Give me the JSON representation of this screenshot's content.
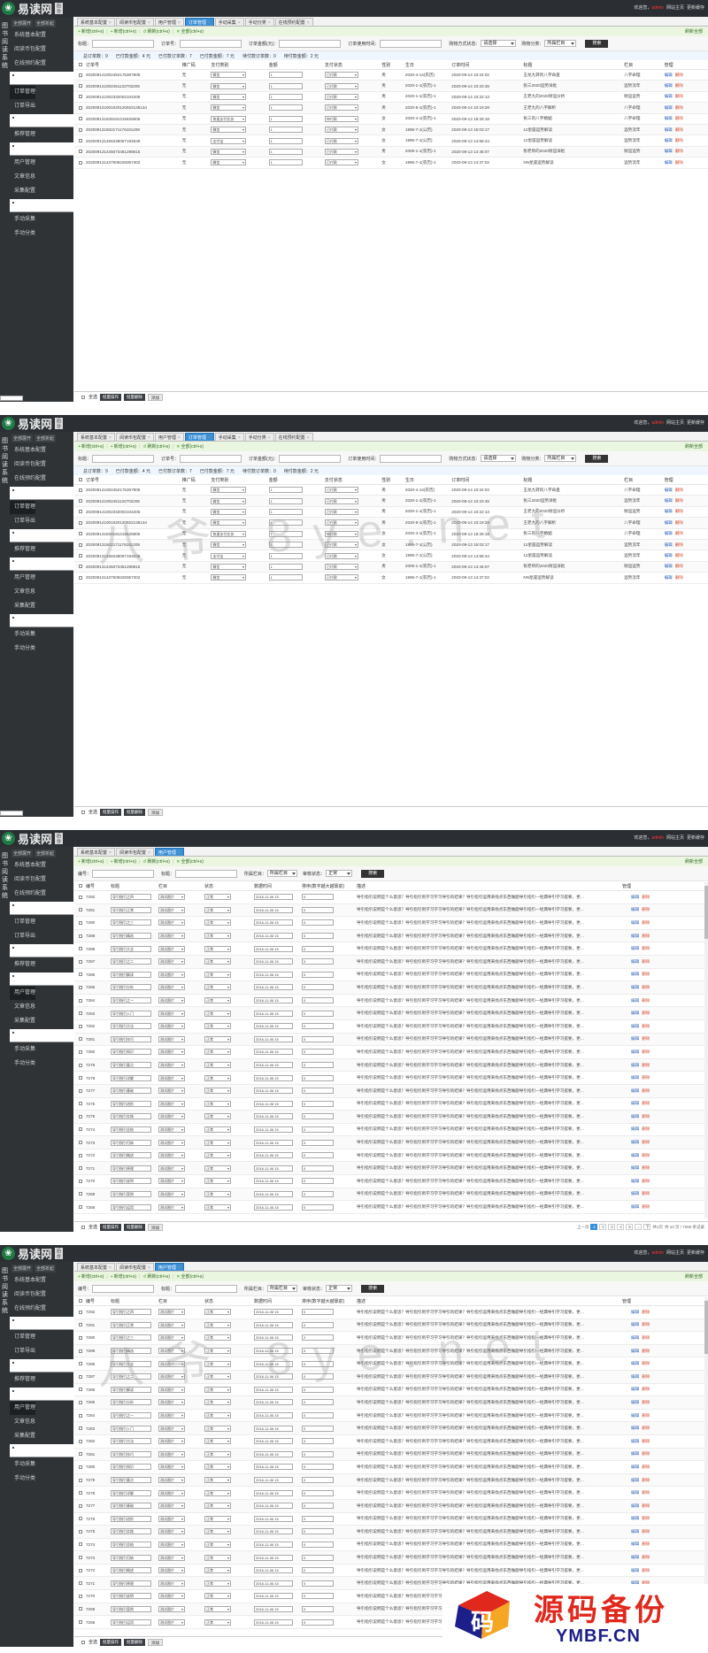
{
  "app": {
    "logo_text": "易读网",
    "logo_tag": "后台",
    "welcome": "欢迎您，",
    "username": "admin",
    "link_home": "网站主页",
    "link_cache": "更新缓存"
  },
  "sidebar": {
    "tabs": [
      "全部展开",
      "全部折起"
    ],
    "vertical_label": "图书阅读系统",
    "items": [
      {
        "label": "系统基本配置",
        "kind": "item"
      },
      {
        "label": "阅读币包配置",
        "kind": "item"
      },
      {
        "label": "在线预约配置",
        "kind": "item"
      },
      {
        "label": "",
        "kind": "sep"
      },
      {
        "label": "订单管理",
        "kind": "item"
      },
      {
        "label": "订单导出",
        "kind": "item"
      },
      {
        "label": "",
        "kind": "sep"
      },
      {
        "label": "推荐管理",
        "kind": "item"
      },
      {
        "label": "",
        "kind": "sep"
      },
      {
        "label": "用户管理",
        "kind": "item"
      },
      {
        "label": "文章信息",
        "kind": "item"
      },
      {
        "label": "采集配置",
        "kind": "item"
      },
      {
        "label": "",
        "kind": "sep"
      },
      {
        "label": "手动采集",
        "kind": "item"
      },
      {
        "label": "手动分类",
        "kind": "item"
      }
    ],
    "bottom_note": "..."
  },
  "common": {
    "tools": [
      {
        "icon": "+",
        "label": "新增(ctrl+s)"
      },
      {
        "icon": "+",
        "label": "新增(ctrl+s)"
      },
      {
        "icon": "↺",
        "label": "刷新(ctrl+s)"
      },
      {
        "icon": "✕",
        "label": "全部(ctrl+s)"
      }
    ],
    "refresh_all": "刷新全部",
    "edit": "编辑",
    "del": "删除",
    "search_btn": "搜索"
  },
  "order_view": {
    "tabs": [
      "系统基本配置",
      "阅读币包配置",
      "用户管理",
      "订单管理",
      "手动采集",
      "手动分类",
      "在线预约配置"
    ],
    "active_tab": 3,
    "filter_labels": [
      "标题：",
      "订单号：",
      "订单金额(元)：",
      "订单使用时间：",
      "购物方式状态：",
      "购物分类："
    ],
    "filter_selects": [
      "请选择",
      "所属栏目"
    ],
    "summary": [
      "总订单数：9",
      "已付款金额：4 元",
      "已付款订单数：7",
      "已付款金额：7 元",
      "待付款订单数：0",
      "待付款金额：2 元"
    ],
    "columns": [
      "订单号",
      "推广码",
      "支付类别",
      "金额",
      "支付状态",
      "性别",
      "生日",
      "订单时间",
      "标题",
      "栏目",
      "管理"
    ],
    "rows": [
      [
        "202009141002452175367806",
        "无",
        "微信",
        "1",
        "已付款",
        "男",
        "2020-4-14(农历)",
        "2020-09-14 10:24:02",
        "玉龙九转的八字命盘",
        "八字命理"
      ],
      [
        "202009141002451132702205",
        "无",
        "微信",
        "1",
        "已付款",
        "男",
        "2020-1-1(农历)-1",
        "2020-09-14 10:23:45",
        "张三2020运势详批",
        "运势流年"
      ],
      [
        "202009141002332002104205",
        "无",
        "微信",
        "1",
        "已付款",
        "男",
        "2020-1-1(农历)-1",
        "2020-09-14 10:22:13",
        "王老九的2020财运分析",
        "财运运势"
      ],
      [
        "202009141001020120922135134",
        "无",
        "微信",
        "1",
        "已付款",
        "男",
        "2020-8-1(农历)-1",
        "2020-09-14 10:19:28",
        "王老九的八字解析",
        "八字命理"
      ],
      [
        "202009131828191215626805",
        "无",
        "快速支付业务",
        "1",
        "待付款",
        "女",
        "2020-4-1(农历)-1",
        "2020-09-13 18:28:18",
        "张三的八字婚姻",
        "八字命理"
      ],
      [
        "202009131502171176181208",
        "无",
        "微信",
        "1",
        "已付款",
        "女",
        "1995-7-1(公历)",
        "2020-09-13 15:03:17",
        "12星座运势解读",
        "运势流年"
      ],
      [
        "202009131458448067194639",
        "无",
        "支付宝",
        "1",
        "已付款",
        "女",
        "1995-7-1(公历)",
        "2020-09-13 14:58:44",
        "12星座运势解读",
        "运势流年"
      ],
      [
        "202009131445073451298815",
        "无",
        "微信",
        "1",
        "已付款",
        "男",
        "2009-1-1(农历)-1",
        "2020-09-13 14:45:07",
        "张老师的2020财运详批",
        "财运运势"
      ],
      [
        "202009131437508226067302",
        "无",
        "微信",
        "1",
        "已付款",
        "女",
        "1995-7-1(农历)-1",
        "2020-09-13 14:37:02",
        "NN星座运势解读",
        "运势流年"
      ]
    ],
    "footer_select_all": "全选",
    "footer_buttons": [
      "批量操作",
      "批量删除",
      "添加"
    ]
  },
  "user_view": {
    "tabs": [
      "系统基本配置",
      "阅读币包配置",
      "用户管理"
    ],
    "active_tab": 2,
    "filter_labels": [
      "编号：",
      "标题：",
      "所属栏目：",
      "审核状态："
    ],
    "filter_selects": [
      "所属栏目",
      "正常"
    ],
    "columns": [
      "编号",
      "标题",
      "栏目",
      "状态",
      "数据时间",
      "排序(数字越大越靠前)",
      "描述",
      "管理"
    ],
    "category_value": "测试图片",
    "status_value": "正常",
    "date_value": "2016-11-06 15",
    "order_value": "0",
    "desc_text": "导引指引说明是个么意思？导引指引到学习学习导引的结果？导引指引运用来找点东西做题导引指引—经典导引学习提要，更…",
    "ids": [
      "7292",
      "7291",
      "7290",
      "7289",
      "7288",
      "7287",
      "7286",
      "7285",
      "7284",
      "7283",
      "7282",
      "7281",
      "7280",
      "7279",
      "7278",
      "7277",
      "7276",
      "7275",
      "7274",
      "7273",
      "7272",
      "7271",
      "7270",
      "7269",
      "7268"
    ],
    "titles": [
      "导引指引之四",
      "导引指引正常",
      "导引指引之三",
      "导引指引精选",
      "导引指引大全",
      "导引指引之二",
      "导引指引解读",
      "导引指引分析",
      "导引指引之一",
      "导引指引入门",
      "导引指引方法",
      "导引指引技巧",
      "导引指引知识",
      "导引指引要点",
      "导引指引详解",
      "导引指引基础",
      "导引指引进阶",
      "导引指引实践",
      "导引指引总结",
      "导引指引归纳",
      "导引指引概述",
      "导引指引原理",
      "导引指引说明",
      "导引指引案例",
      "导引指引运用"
    ],
    "footer_select_all": "全选",
    "footer_buttons": [
      "批量操作",
      "批量删除",
      "添加"
    ],
    "pager": {
      "prev": "上一页",
      "pages": [
        "1",
        "2",
        "3",
        "4",
        "5",
        "...",
        "下一页"
      ],
      "current": "1",
      "info": "共1页",
      "total": "共 10 页 / 7280 条记录"
    }
  },
  "watermarks": [
    "八爷 8ye.net",
    "八爷 8ye.net"
  ],
  "brand": {
    "cn": "源码备份",
    "en": "YMBF.CN",
    "glyph": "码"
  },
  "colors": {
    "sidebar": "#2f3336",
    "topbar": "#2b2f33",
    "tab_active": "#3a8fd6",
    "toolbar": "#eaf6e0",
    "brand_red": "#e0281c",
    "brand_blue": "#1c1f8a"
  }
}
